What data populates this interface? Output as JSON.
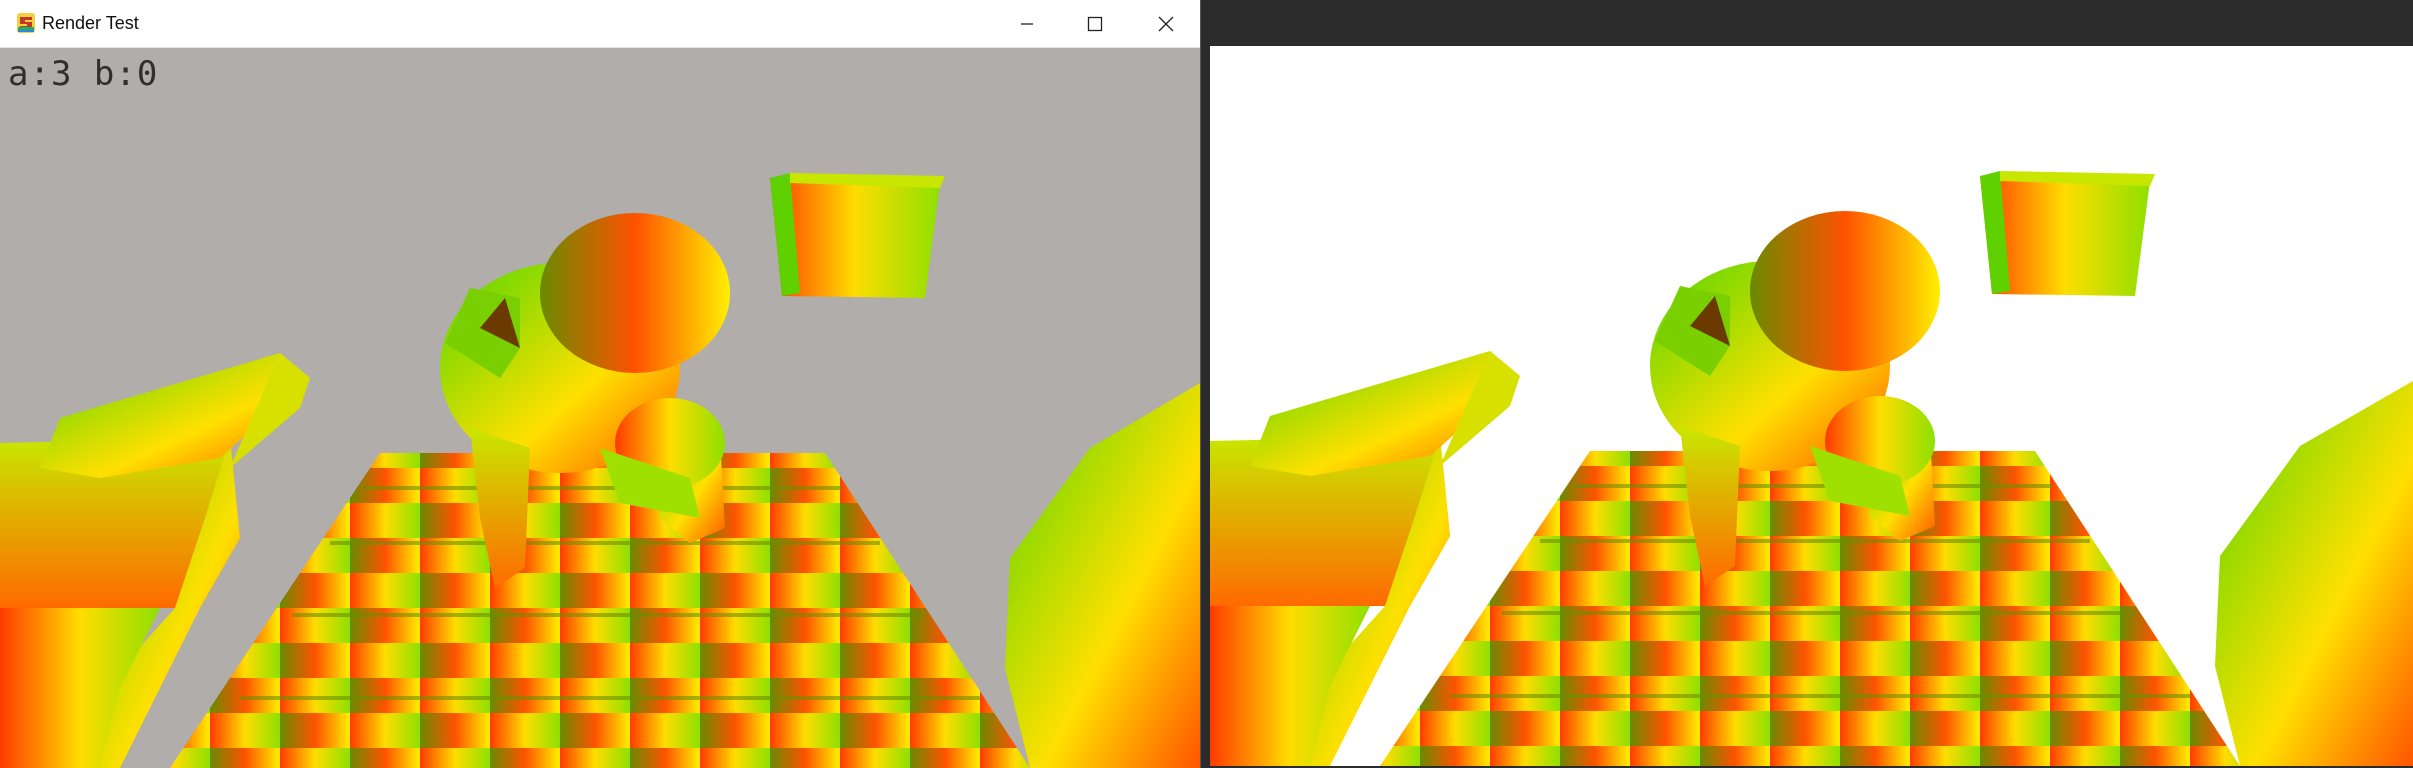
{
  "window": {
    "title": "Render Test",
    "controls": {
      "minimize": "minimize-icon",
      "maximize": "maximize-icon",
      "close": "close-icon"
    }
  },
  "hud": {
    "text": "a:3 b:0"
  },
  "colors": {
    "left_background": "#b0adaa",
    "right_background": "#ffffff",
    "frame_background": "#2b2b2b",
    "hud_text": "#2f2f2f"
  }
}
